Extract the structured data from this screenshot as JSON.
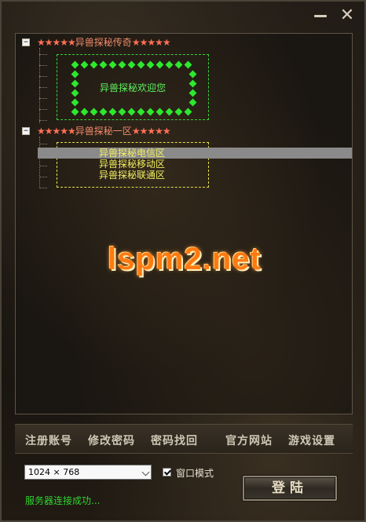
{
  "window": {
    "minimize_icon": "minimize-icon",
    "close_icon": "close-icon",
    "close_glyph": "✕"
  },
  "server_list": {
    "groups": [
      {
        "expander": "−",
        "stars": "★★★★★",
        "name": "异兽探秘传奇",
        "children_box": {
          "text": "异兽探秘欢迎您",
          "border_color": "#3ccf3c"
        }
      },
      {
        "expander": "−",
        "stars": "★★★★★",
        "name": "异兽探秘一区",
        "servers": [
          "异兽探秘电信区",
          "异兽探秘移动区",
          "异兽探秘联通区"
        ],
        "selected_index": 0,
        "border_color": "#e6e04a"
      }
    ]
  },
  "watermark": "lspm2.net",
  "menu": {
    "register": "注册账号",
    "change_password": "修改密码",
    "recover_password": "密码找回",
    "official_site": "官方网站",
    "game_settings": "游戏设置"
  },
  "resolution_select": {
    "value": "1024 × 768"
  },
  "window_mode": {
    "label": "窗口模式",
    "checked": true
  },
  "login_button": "登陆",
  "status": "服务器连接成功..."
}
